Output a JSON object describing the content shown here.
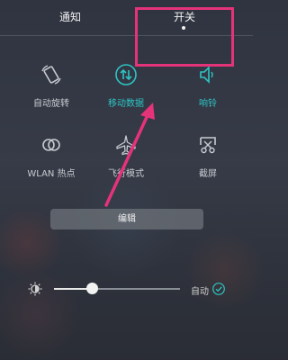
{
  "tabs": {
    "notifications": "通知",
    "toggles": "开关"
  },
  "toggles": [
    {
      "label": "自动旋转",
      "icon": "auto-rotate-icon",
      "active": false
    },
    {
      "label": "移动数据",
      "icon": "mobile-data-icon",
      "active": true
    },
    {
      "label": "响铃",
      "icon": "ringer-icon",
      "active": true
    },
    {
      "label": "WLAN 热点",
      "icon": "hotspot-icon",
      "active": false
    },
    {
      "label": "飞行模式",
      "icon": "airplane-icon",
      "active": false
    },
    {
      "label": "截屏",
      "icon": "screenshot-icon",
      "active": false
    }
  ],
  "edit_button": "编辑",
  "brightness": {
    "level": 0.3,
    "auto_label": "自动",
    "auto_enabled": true
  },
  "colors": {
    "accent": "#2ec4c4",
    "annotation": "#e5337a"
  }
}
